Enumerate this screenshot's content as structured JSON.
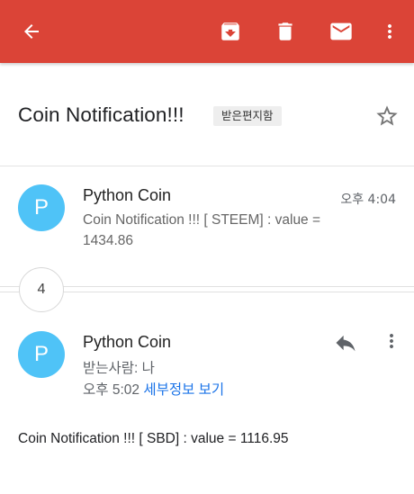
{
  "toolbar": {
    "back_icon": "arrow-back-icon",
    "archive_icon": "archive-icon",
    "delete_icon": "trash-icon",
    "mark_unread_icon": "mail-icon",
    "more_icon": "more-vert-icon",
    "color": "#db4437"
  },
  "thread": {
    "subject": "Coin Notification!!!",
    "label": "받은편지함",
    "star_icon": "star-outline-icon",
    "collapsed_count": "4"
  },
  "messages": [
    {
      "avatar_letter": "P",
      "sender": "Python Coin",
      "time": "오후 4:04",
      "snippet_line1": "Coin Notification !!! [ STEEM] : value =",
      "snippet_line2": "1434.86"
    },
    {
      "avatar_letter": "P",
      "sender": "Python Coin",
      "recipient": "받는사람: 나",
      "time": "오후 5:02",
      "details_link": "세부정보 보기",
      "body": "Coin Notification !!! [ SBD] : value = 1116.95",
      "reply_icon": "reply-icon",
      "more_icon": "more-vert-icon"
    }
  ],
  "colors": {
    "avatar": "#4fc3f7",
    "link": "#1a73e8"
  }
}
